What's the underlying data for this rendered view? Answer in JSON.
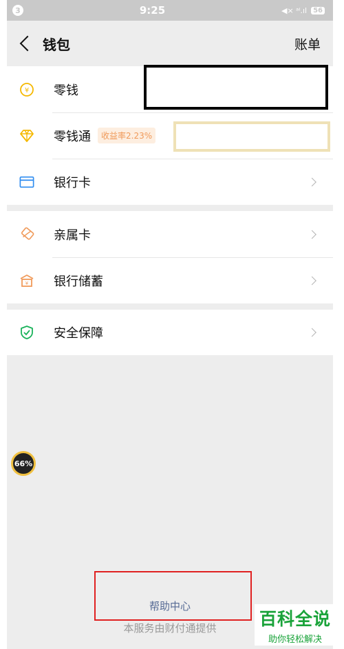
{
  "status_bar": {
    "left_badge": "3",
    "time": "9:25",
    "signal": "◀× ᵃⁱ.ıl",
    "battery": "56"
  },
  "nav": {
    "title": "钱包",
    "right_label": "账单"
  },
  "wallet": {
    "items": [
      {
        "label": "零钱",
        "icon": "coin-icon"
      },
      {
        "label": "零钱通",
        "badge": "收益率2.23%",
        "icon": "diamond-icon"
      },
      {
        "label": "银行卡",
        "icon": "card-icon"
      }
    ]
  },
  "cards": {
    "items": [
      {
        "label": "亲属卡",
        "icon": "family-card-icon"
      },
      {
        "label": "银行储蓄",
        "icon": "bank-icon"
      }
    ]
  },
  "security": {
    "items": [
      {
        "label": "安全保障",
        "icon": "shield-icon"
      }
    ]
  },
  "float_badge": "66%",
  "help_link": "帮助中心",
  "footer": "本服务由财付通提供",
  "watermark": {
    "main": "百科全说",
    "sub": "助你轻松解决"
  },
  "colors": {
    "accent_yellow": "#f5b800",
    "accent_blue": "#2e8cf0",
    "accent_orange": "#f09a5a",
    "accent_green": "#19b25a",
    "link": "#576b95"
  }
}
